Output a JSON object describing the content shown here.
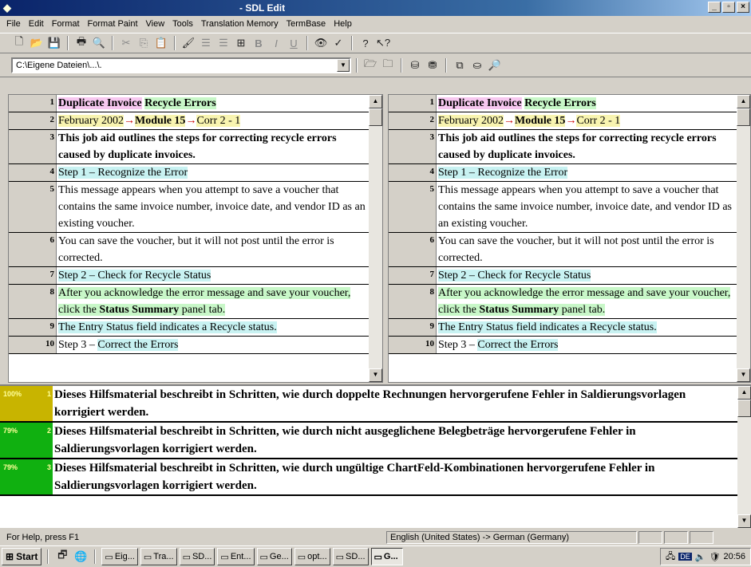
{
  "window": {
    "title": "- SDL Edit"
  },
  "menu": [
    "File",
    "Edit",
    "Format",
    "Format Paint",
    "View",
    "Tools",
    "Translation Memory",
    "TermBase",
    "Help"
  ],
  "path_combo": {
    "value": "C:\\Eigene Dateien\\...\\."
  },
  "source": [
    {
      "n": "1",
      "parts": [
        {
          "t": "Duplicate Invoice",
          "c": "pink bold"
        },
        {
          "t": " ",
          "c": ""
        },
        {
          "t": "Recycle Errors",
          "c": "green bold"
        }
      ]
    },
    {
      "n": "2",
      "parts": [
        {
          "t": "February 2002",
          "c": "yellow"
        },
        {
          "t": "→",
          "c": "red"
        },
        {
          "t": "Module 15",
          "c": "bold yellow"
        },
        {
          "t": "→",
          "c": "red"
        },
        {
          "t": "Corr 2 - 1",
          "c": "yellow"
        }
      ]
    },
    {
      "n": "3",
      "parts": [
        {
          "t": "This job aid outlines the steps for correcting recycle errors caused by duplicate invoices.",
          "c": "bold"
        }
      ]
    },
    {
      "n": "4",
      "parts": [
        {
          "t": "Step 1 – Recognize the Error",
          "c": "cyan"
        }
      ]
    },
    {
      "n": "5",
      "parts": [
        {
          "t": "This message appears when you attempt to save a voucher that contains the same invoice number, invoice date, and vendor ID as an existing voucher.",
          "c": ""
        }
      ]
    },
    {
      "n": "6",
      "parts": [
        {
          "t": "You can save the voucher, but it will not post until the error is corrected.",
          "c": ""
        }
      ]
    },
    {
      "n": "7",
      "parts": [
        {
          "t": "Step 2 – Check for Recycle Status",
          "c": "cyan"
        }
      ]
    },
    {
      "n": "8",
      "parts": [
        {
          "t": "After you acknowledge the error message and save your voucher, click the ",
          "c": "green"
        },
        {
          "t": "Status Summary",
          "c": "green bold"
        },
        {
          "t": " panel tab.",
          "c": "green"
        }
      ]
    },
    {
      "n": "9",
      "parts": [
        {
          "t": "The Entry Status field indicates a Recycle status.",
          "c": "cyan"
        }
      ]
    },
    {
      "n": "10",
      "parts": [
        {
          "t": "Step 3 – ",
          "c": ""
        },
        {
          "t": "Correct the Errors",
          "c": "cyan"
        }
      ]
    }
  ],
  "target": [
    {
      "n": "1",
      "parts": [
        {
          "t": "Duplicate Invoice",
          "c": "pink bold"
        },
        {
          "t": " ",
          "c": ""
        },
        {
          "t": "Recycle Errors",
          "c": "green bold"
        }
      ]
    },
    {
      "n": "2",
      "parts": [
        {
          "t": "February 2002",
          "c": "yellow"
        },
        {
          "t": "→",
          "c": "red"
        },
        {
          "t": "Module 15",
          "c": "bold yellow"
        },
        {
          "t": "→",
          "c": "red"
        },
        {
          "t": "Corr 2 - 1",
          "c": "yellow"
        }
      ]
    },
    {
      "n": "3",
      "parts": [
        {
          "t": "This job aid outlines the steps for correcting recycle errors caused by duplicate invoices.",
          "c": "bold"
        }
      ]
    },
    {
      "n": "4",
      "parts": [
        {
          "t": "Step 1 – Recognize the Error",
          "c": "cyan"
        }
      ]
    },
    {
      "n": "5",
      "parts": [
        {
          "t": "This message appears when you attempt to save a voucher that contains the same invoice number, invoice date, and vendor ID as an existing voucher.",
          "c": ""
        }
      ]
    },
    {
      "n": "6",
      "parts": [
        {
          "t": "You can save the voucher, but it will not post until the error is corrected.",
          "c": ""
        }
      ]
    },
    {
      "n": "7",
      "parts": [
        {
          "t": "Step 2 – Check for Recycle Status",
          "c": "cyan"
        }
      ]
    },
    {
      "n": "8",
      "parts": [
        {
          "t": "After you acknowledge the error message and save your voucher, click the ",
          "c": "green"
        },
        {
          "t": "Status Summary",
          "c": "green bold"
        },
        {
          "t": " panel tab.",
          "c": "green"
        }
      ]
    },
    {
      "n": "9",
      "parts": [
        {
          "t": "The Entry Status field indicates a Recycle status.",
          "c": "cyan"
        }
      ]
    },
    {
      "n": "10",
      "parts": [
        {
          "t": "Step 3 – ",
          "c": ""
        },
        {
          "t": "Correct the Errors",
          "c": "cyan"
        }
      ]
    }
  ],
  "tm_matches": [
    {
      "pct": "100%",
      "n": "1",
      "color": "#c8b400",
      "text": "Dieses Hilfsmaterial beschreibt in Schritten, wie durch doppelte Rechnungen hervorgerufene Fehler in Saldierungsvorlagen korrigiert werden."
    },
    {
      "pct": "79%",
      "n": "2",
      "color": "#10b010",
      "text": "Dieses Hilfsmaterial beschreibt in Schritten, wie durch nicht ausgeglichene Belegbeträge hervorgerufene Fehler in Saldierungsvorlagen korrigiert werden."
    },
    {
      "pct": "79%",
      "n": "3",
      "color": "#10b010",
      "text": "Dieses Hilfsmaterial beschreibt in Schritten, wie durch ungültige ChartFeld-Kombinationen hervorgerufene Fehler in Saldierungsvorlagen korrigiert werden."
    }
  ],
  "status": {
    "help": "For Help, press F1",
    "lang": "English (United States) -> German (Germany)"
  },
  "taskbar": {
    "start": "Start",
    "tasks": [
      "Eig...",
      "Tra...",
      "SD...",
      "Ent...",
      "Ge...",
      "opt...",
      "SD...",
      "G..."
    ],
    "clock": "20:56"
  }
}
